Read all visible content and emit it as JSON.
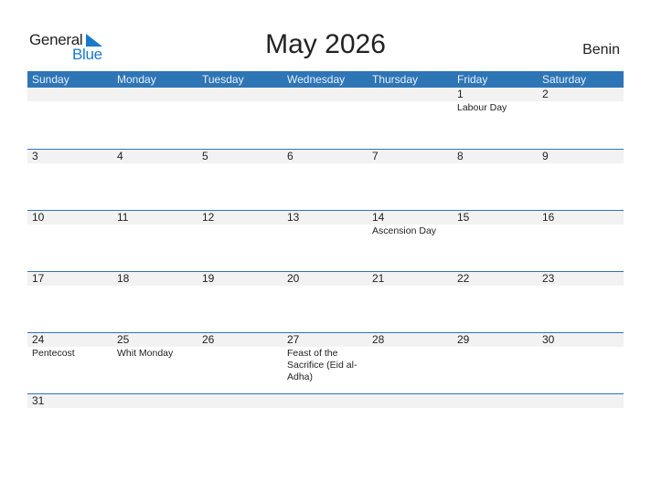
{
  "logo": {
    "line1": "General",
    "line2": "Blue"
  },
  "title": "May 2026",
  "country": "Benin",
  "weekdays": [
    "Sunday",
    "Monday",
    "Tuesday",
    "Wednesday",
    "Thursday",
    "Friday",
    "Saturday"
  ],
  "weeks": [
    [
      {
        "num": "",
        "event": ""
      },
      {
        "num": "",
        "event": ""
      },
      {
        "num": "",
        "event": ""
      },
      {
        "num": "",
        "event": ""
      },
      {
        "num": "",
        "event": ""
      },
      {
        "num": "1",
        "event": "Labour Day"
      },
      {
        "num": "2",
        "event": ""
      }
    ],
    [
      {
        "num": "3",
        "event": ""
      },
      {
        "num": "4",
        "event": ""
      },
      {
        "num": "5",
        "event": ""
      },
      {
        "num": "6",
        "event": ""
      },
      {
        "num": "7",
        "event": ""
      },
      {
        "num": "8",
        "event": ""
      },
      {
        "num": "9",
        "event": ""
      }
    ],
    [
      {
        "num": "10",
        "event": ""
      },
      {
        "num": "11",
        "event": ""
      },
      {
        "num": "12",
        "event": ""
      },
      {
        "num": "13",
        "event": ""
      },
      {
        "num": "14",
        "event": "Ascension Day"
      },
      {
        "num": "15",
        "event": ""
      },
      {
        "num": "16",
        "event": ""
      }
    ],
    [
      {
        "num": "17",
        "event": ""
      },
      {
        "num": "18",
        "event": ""
      },
      {
        "num": "19",
        "event": ""
      },
      {
        "num": "20",
        "event": ""
      },
      {
        "num": "21",
        "event": ""
      },
      {
        "num": "22",
        "event": ""
      },
      {
        "num": "23",
        "event": ""
      }
    ],
    [
      {
        "num": "24",
        "event": "Pentecost"
      },
      {
        "num": "25",
        "event": "Whit Monday"
      },
      {
        "num": "26",
        "event": ""
      },
      {
        "num": "27",
        "event": "Feast of the Sacrifice (Eid al-Adha)"
      },
      {
        "num": "28",
        "event": ""
      },
      {
        "num": "29",
        "event": ""
      },
      {
        "num": "30",
        "event": ""
      }
    ],
    [
      {
        "num": "31",
        "event": ""
      },
      {
        "num": "",
        "event": ""
      },
      {
        "num": "",
        "event": ""
      },
      {
        "num": "",
        "event": ""
      },
      {
        "num": "",
        "event": ""
      },
      {
        "num": "",
        "event": ""
      },
      {
        "num": "",
        "event": ""
      }
    ]
  ],
  "colors": {
    "header": "#2e75b6",
    "brand_blue": "#1a7ac7",
    "date_band": "#f2f2f2"
  }
}
